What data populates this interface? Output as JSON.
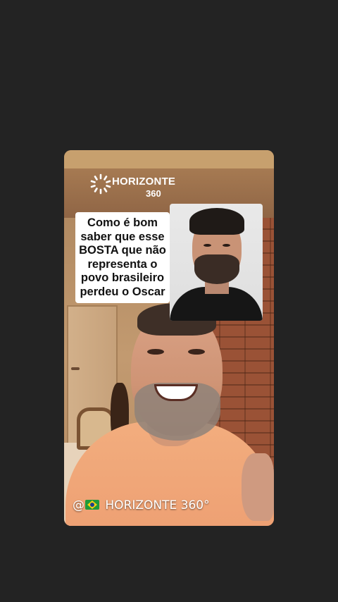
{
  "screen": {
    "background_color": "#232323"
  },
  "video": {
    "logo": {
      "name": "HORIZONTE",
      "sub": "360",
      "icon": "sun-burst-icon"
    },
    "caption": {
      "text": "Como é bom\nsaber que esse\nBOSTA que não\nrepresenta o\npovo brasileiro\nperdeu o Oscar"
    },
    "inset_photo": {
      "description_icon": "portrait-photo"
    },
    "watermark": {
      "prefix": "@",
      "flag_icon": "brazil-flag-icon",
      "text": " HORIZONTE 360°"
    }
  }
}
